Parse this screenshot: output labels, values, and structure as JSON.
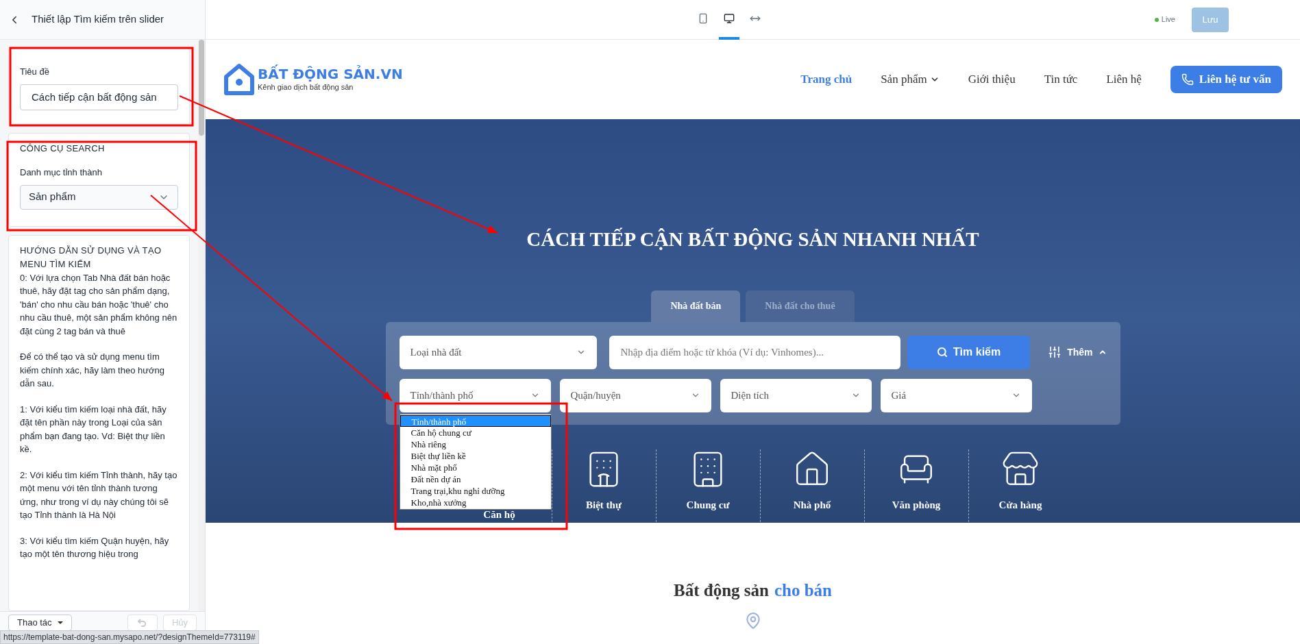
{
  "sidebar": {
    "title": "Thiết lập Tìm kiếm trên slider",
    "title_field": {
      "label": "Tiêu đề",
      "value": "Cách tiếp cận bất động sản"
    },
    "search_tool": {
      "heading": "CÔNG CỤ SEARCH",
      "label": "Danh mục tỉnh thành",
      "value": "Sản phẩm"
    },
    "guide": {
      "heading": "HƯỚNG DẪN SỬ DỤNG VÀ TẠO MENU TÌM KIẾM",
      "paragraphs": [
        "0: Với lựa chọn Tab Nhà đất bán hoặc thuê, hãy đặt tag cho sản phẩm dạng, 'bán' cho nhu cầu bán hoặc 'thuê' cho nhu cầu thuê, một sản phẩm không nên đặt cùng 2 tag bán và thuê",
        "Để có thể tạo và sử dụng menu tìm kiếm chính xác, hãy làm theo hướng dẫn sau.",
        "1: Với kiểu tìm kiếm loại nhà đất, hãy đặt tên phần này trong Loại của sản phẩm bạn đang tạo. Vd: Biệt thự liền kề.",
        "2: Với kiểu tìm kiếm Tỉnh thành, hãy tạo một menu với tên tỉnh thành tương ứng, như trong ví dụ này chúng tôi sẽ tạo Tỉnh thành là Hà Nội",
        "3: Với kiểu tìm kiếm Quận huyện, hãy tạo một tên thương hiệu trong"
      ]
    },
    "footer": {
      "actions_button": "Thao tác",
      "undo": {
        "disabled": true
      },
      "cancel_button": {
        "label": "Hủy",
        "disabled": true
      }
    }
  },
  "toolbar": {
    "devices": [
      {
        "kind": "mobile",
        "selected": false
      },
      {
        "kind": "desktop",
        "selected": true
      },
      {
        "kind": "fullwidth",
        "selected": false
      }
    ],
    "live": "Live",
    "save_button": {
      "label": "Lưu",
      "disabled": true
    }
  },
  "site": {
    "logo": {
      "name": "BẤT ĐỘNG SẢN.VN",
      "tagline": "Kênh giao dịch bất động sản"
    },
    "nav": [
      {
        "label": "Trang chủ",
        "selected": true,
        "has_menu": false
      },
      {
        "label": "Sản phẩm",
        "selected": false,
        "has_menu": true
      },
      {
        "label": "Giới thiệu",
        "selected": false,
        "has_menu": false
      },
      {
        "label": "Tin tức",
        "selected": false,
        "has_menu": false
      },
      {
        "label": "Liên hệ",
        "selected": false,
        "has_menu": false
      }
    ],
    "cta_button": "Liên hệ tư vấn",
    "hero": {
      "title": "CÁCH TIẾP CẬN BẤT ĐỘNG SẢN NHANH NHẤT",
      "tabs": [
        {
          "label": "Nhà đất bán",
          "selected": true
        },
        {
          "label": "Nhà đất cho thuê",
          "selected": false
        }
      ],
      "search": {
        "type_select": "Loại nhà đất",
        "keyword_placeholder": "Nhập địa điểm hoặc từ khóa (Ví dụ: Vinhomes)...",
        "search_button": "Tìm kiếm",
        "more": "Thêm",
        "filters": [
          "Tỉnh/thành phố",
          "Quận/huyện",
          "Diện tích",
          "Giá"
        ],
        "open_list": [
          {
            "label": "Tỉnh/thành phố",
            "selected": true
          },
          {
            "label": "Căn hộ chung cư",
            "selected": false
          },
          {
            "label": "Nhà riêng",
            "selected": false
          },
          {
            "label": "Biệt thự liền kề",
            "selected": false
          },
          {
            "label": "Nhà mặt phố",
            "selected": false
          },
          {
            "label": "Đất nền dự án",
            "selected": false
          },
          {
            "label": "Trang trại,khu nghỉ dưỡng",
            "selected": false
          },
          {
            "label": "Kho,nhà xưởng",
            "selected": false
          }
        ]
      },
      "categories": [
        {
          "kind": "apartment",
          "label": "Căn hộ"
        },
        {
          "kind": "villa",
          "label": "Biệt thự"
        },
        {
          "kind": "condo",
          "label": "Chung cư"
        },
        {
          "kind": "townhouse",
          "label": "Nhà phố"
        },
        {
          "kind": "office",
          "label": "Văn phòng"
        },
        {
          "kind": "shop",
          "label": "Cửa hàng"
        }
      ]
    },
    "section": {
      "title": "Bất động sản",
      "title_highlight": "cho bán"
    }
  },
  "status_bar": "https://template-bat-dong-san.mysapo.net/?designThemeId=773119#"
}
